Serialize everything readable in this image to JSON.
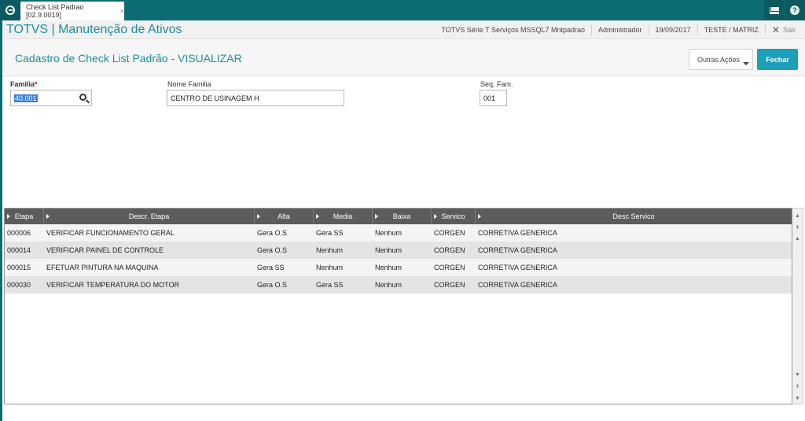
{
  "tab": {
    "label": "Check List Padrao [02.9.0019]",
    "close": "×"
  },
  "app": {
    "title": "TOTVS | Manutenção de Ativos"
  },
  "header": {
    "environment": "TOTVS Série T Serviços MSSQL7 Mntpadrao",
    "user": "Administrador",
    "date": "19/09/2017",
    "company": "TESTE / MATRIZ",
    "logout": "Sair"
  },
  "page": {
    "title": "Cadastro de Check List Padrão - VISUALIZAR",
    "outras_acoes": "Outras Ações",
    "fechar": "Fechar"
  },
  "form": {
    "familia": {
      "label": "Familia",
      "required": "*",
      "value": "40.001"
    },
    "nome_familia": {
      "label": "Nome Familia",
      "value": "CENTRO DE USINAGEM H"
    },
    "seq_fam": {
      "label": "Seq. Fam.",
      "value": "001"
    }
  },
  "grid": {
    "columns": [
      "Etapa",
      "Descr. Etapa",
      "Alta",
      "Media",
      "Baixa",
      "Servico",
      "Desc Servico"
    ],
    "rows": [
      [
        "000006",
        "VERIFICAR FUNCIONAMENTO GERAL",
        "Gera O.S",
        "Gera SS",
        "Nenhum",
        "CORGEN",
        "CORRETIVA GENERICA"
      ],
      [
        "000014",
        "VERIFICAR PAINEL DE CONTROLE",
        "Gera O.S",
        "Nenhum",
        "Nenhum",
        "CORGEN",
        "CORRETIVA GENERICA"
      ],
      [
        "000015",
        "EFETUAR PINTURA NA MAQUINA",
        "Gera SS",
        "Nenhum",
        "Nenhum",
        "CORGEN",
        "CORRETIVA GENERICA"
      ],
      [
        "000030",
        "VERIFICAR TEMPERATURA DO MOTOR",
        "Gera O.S",
        "Gera SS",
        "Nenhum",
        "CORGEN",
        "CORRETIVA GENERICA"
      ]
    ]
  },
  "icons": {
    "logo": "totvs-logo-icon",
    "mail": "mail-icon",
    "help": "help-icon",
    "search": "search-icon",
    "close": "close-icon"
  },
  "colors": {
    "teal": "#0d6c73",
    "accent": "#1c8ea1",
    "button": "#1c9fb8"
  }
}
